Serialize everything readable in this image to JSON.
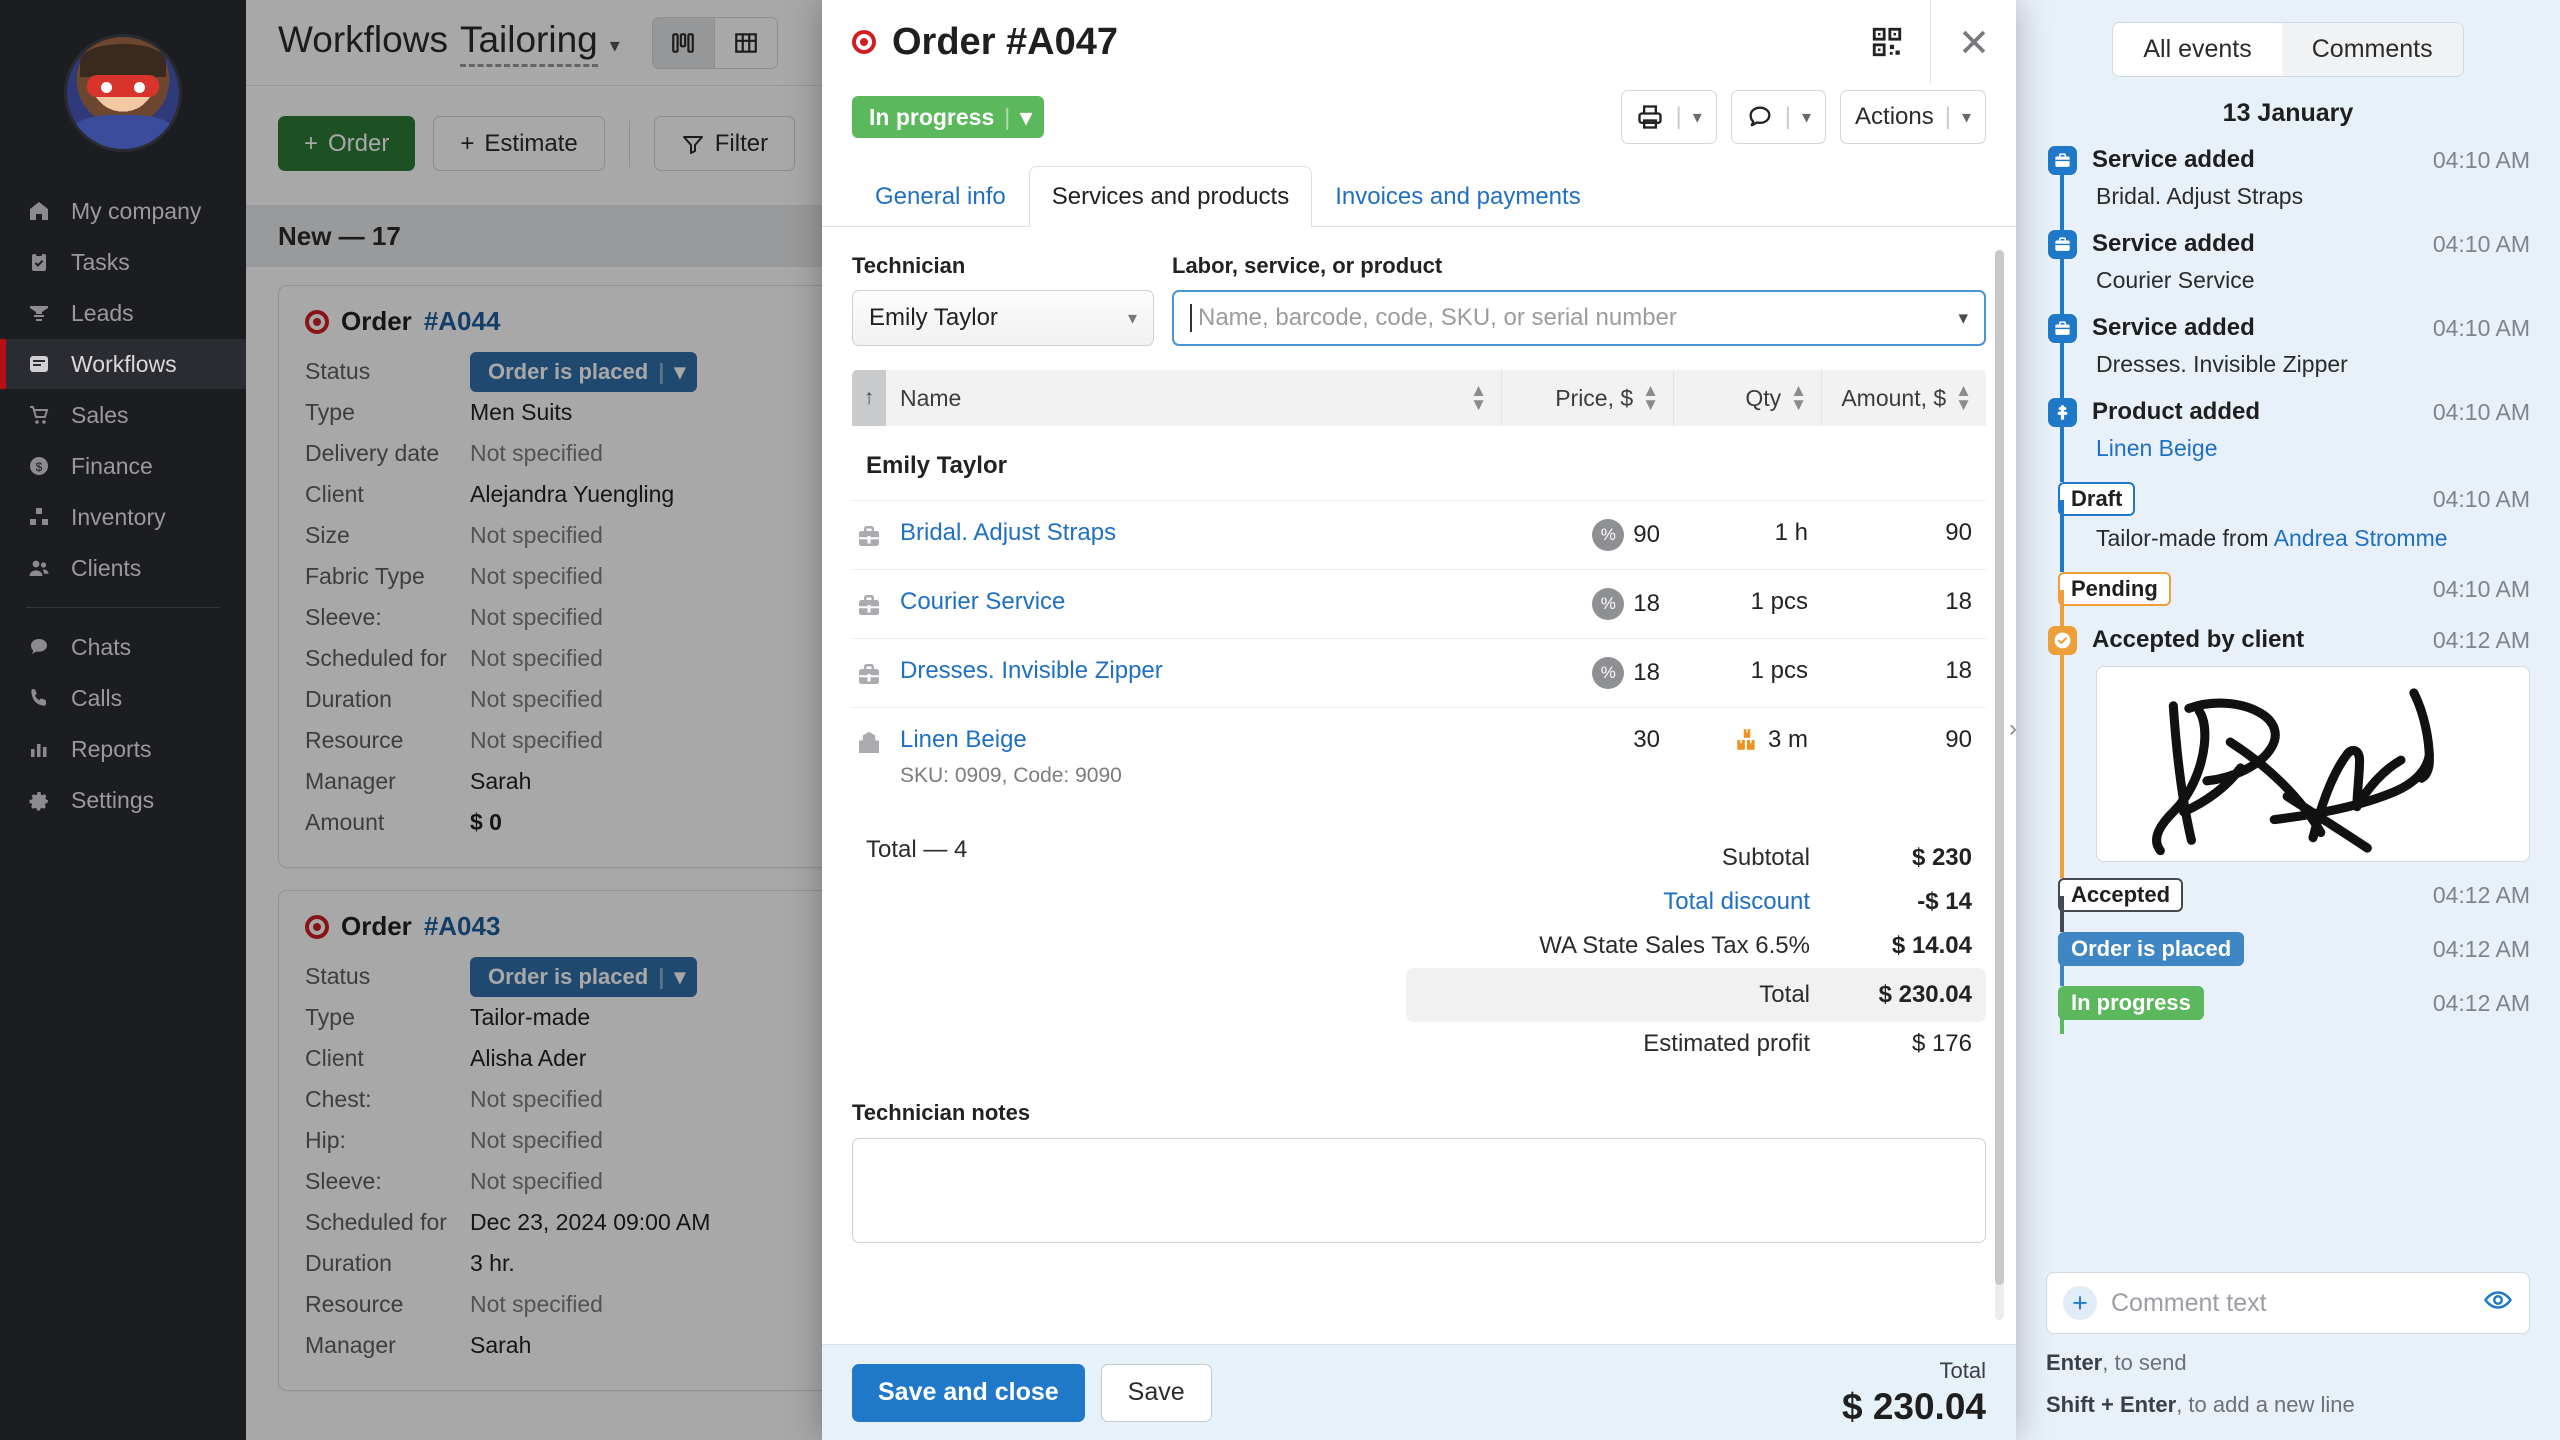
{
  "sidebar": {
    "avatar_name": "user-avatar",
    "items": [
      {
        "label": "My company",
        "icon": "home-icon"
      },
      {
        "label": "Tasks",
        "icon": "clipboard-check-icon"
      },
      {
        "label": "Leads",
        "icon": "funnel-icon"
      },
      {
        "label": "Workflows",
        "icon": "inbox-icon",
        "active": true
      },
      {
        "label": "Sales",
        "icon": "cart-icon"
      },
      {
        "label": "Finance",
        "icon": "dollar-circle-icon"
      },
      {
        "label": "Inventory",
        "icon": "boxes-icon"
      },
      {
        "label": "Clients",
        "icon": "people-icon"
      },
      {
        "label": "Chats",
        "icon": "chat-icon"
      },
      {
        "label": "Calls",
        "icon": "phone-icon"
      },
      {
        "label": "Reports",
        "icon": "bar-chart-icon"
      },
      {
        "label": "Settings",
        "icon": "gear-icon"
      }
    ]
  },
  "background": {
    "title_primary": "Workflows",
    "title_secondary": "Tailoring",
    "buttons": {
      "order": "Order",
      "estimate": "Estimate",
      "filter": "Filter"
    },
    "column_header": "New — 17",
    "cards": [
      {
        "number": "#A044",
        "prefix": "Order",
        "status": "Order is placed",
        "rows": [
          {
            "label": "Type",
            "value": "Men Suits",
            "muted": false
          },
          {
            "label": "Delivery date",
            "value": "Not specified",
            "muted": true
          },
          {
            "label": "Client",
            "value": "Alejandra Yuengling",
            "muted": false
          },
          {
            "label": "Size",
            "value": "Not specified",
            "muted": true
          },
          {
            "label": "Fabric Type",
            "value": "Not specified",
            "muted": true
          },
          {
            "label": "Sleeve:",
            "value": "Not specified",
            "muted": true
          },
          {
            "label": "Scheduled for",
            "value": "Not specified",
            "muted": true
          },
          {
            "label": "Duration",
            "value": "Not specified",
            "muted": true
          },
          {
            "label": "Resource",
            "value": "Not specified",
            "muted": true
          },
          {
            "label": "Manager",
            "value": "Sarah",
            "muted": false
          },
          {
            "label": "Amount",
            "value": "$ 0",
            "muted": false,
            "bold": true
          }
        ],
        "status_label": "Status"
      },
      {
        "number": "#A043",
        "prefix": "Order",
        "status": "Order is placed",
        "rows": [
          {
            "label": "Type",
            "value": "Tailor-made",
            "muted": false
          },
          {
            "label": "Client",
            "value": "Alisha Ader",
            "muted": false
          },
          {
            "label": "Chest:",
            "value": "Not specified",
            "muted": true
          },
          {
            "label": "Hip:",
            "value": "Not specified",
            "muted": true
          },
          {
            "label": "Sleeve:",
            "value": "Not specified",
            "muted": true
          },
          {
            "label": "Scheduled for",
            "value": "Dec 23, 2024 09:00 AM",
            "muted": false
          },
          {
            "label": "Duration",
            "value": "3 hr.",
            "muted": false
          },
          {
            "label": "Resource",
            "value": "Not specified",
            "muted": true
          },
          {
            "label": "Manager",
            "value": "Sarah",
            "muted": false
          }
        ],
        "status_label": "Status"
      }
    ]
  },
  "modal": {
    "title": "Order #A047",
    "status_badge": "In progress",
    "toolbar": {
      "print": "print-icon",
      "comment": "comment-icon",
      "actions": "Actions"
    },
    "tabs": [
      {
        "label": "General info",
        "active": false
      },
      {
        "label": "Services and products",
        "active": true
      },
      {
        "label": "Invoices and payments",
        "active": false
      }
    ],
    "technician_label": "Technician",
    "technician_value": "Emily Taylor",
    "search_label": "Labor, service, or product",
    "search_placeholder": "Name, barcode, code, SKU, or serial number",
    "table": {
      "headers": {
        "name": "Name",
        "price": "Price, $",
        "qty": "Qty",
        "amount": "Amount, $"
      },
      "group": "Emily Taylor",
      "rows": [
        {
          "name": "Bridal. Adjust Straps",
          "icon": "service-toolbox-icon",
          "has_discount": true,
          "price": "90",
          "qty": "1 h",
          "qty_icon": false,
          "amount": "90",
          "sub": ""
        },
        {
          "name": "Courier Service",
          "icon": "service-toolbox-icon",
          "has_discount": true,
          "price": "18",
          "qty": "1 pcs",
          "qty_icon": false,
          "amount": "18",
          "sub": ""
        },
        {
          "name": "Dresses. Invisible Zipper",
          "icon": "service-toolbox-icon",
          "has_discount": true,
          "price": "18",
          "qty": "1 pcs",
          "qty_icon": false,
          "amount": "18",
          "sub": ""
        },
        {
          "name": "Linen Beige",
          "icon": "product-box-icon",
          "has_discount": false,
          "price": "30",
          "qty": "3 m",
          "qty_icon": true,
          "amount": "90",
          "sub": "SKU: 0909, Code: 9090"
        }
      ]
    },
    "totals": {
      "count_label": "Total — 4",
      "subtotal_label": "Subtotal",
      "subtotal_value": "$ 230",
      "discount_label": "Total discount",
      "discount_value": "-$ 14",
      "tax_label": "WA State Sales Tax 6.5%",
      "tax_value": "$ 14.04",
      "total_label": "Total",
      "total_value": "$ 230.04",
      "profit_label": "Estimated profit",
      "profit_value": "$ 176"
    },
    "notes_label": "Technician notes",
    "notes_value": "",
    "footer": {
      "save_and_close": "Save and close",
      "save": "Save",
      "total_label": "Total",
      "total_value": "$ 230.04"
    }
  },
  "activity": {
    "tabs": [
      {
        "label": "All events",
        "active": true
      },
      {
        "label": "Comments",
        "active": false
      }
    ],
    "day": "13 January",
    "events": [
      {
        "kind": "icon",
        "icon": "briefcase-icon",
        "color": "#2079c8",
        "line_color": "#2079c8",
        "title": "Service added",
        "time": "04:10 AM",
        "sub": "Bridal. Adjust Straps"
      },
      {
        "kind": "icon",
        "icon": "briefcase-icon",
        "color": "#2079c8",
        "line_color": "#2079c8",
        "title": "Service added",
        "time": "04:10 AM",
        "sub": "Courier Service"
      },
      {
        "kind": "icon",
        "icon": "briefcase-icon",
        "color": "#2079c8",
        "line_color": "#2079c8",
        "title": "Service added",
        "time": "04:10 AM",
        "sub": "Dresses. Invisible Zipper"
      },
      {
        "kind": "icon",
        "icon": "puzzle-icon",
        "color": "#2079c8",
        "line_color": "#2079c8",
        "title": "Product added",
        "time": "04:10 AM",
        "sub_link": "Linen Beige"
      },
      {
        "kind": "badge-outline",
        "badge": "Draft",
        "border_color": "#2079c8",
        "line_color": "#2079c8",
        "time": "04:10 AM",
        "sub_prefix": "Tailor-made from ",
        "sub_link": "Andrea Stromme"
      },
      {
        "kind": "badge-outline",
        "badge": "Pending",
        "border_color": "#eda03a",
        "line_color": "#eda03a",
        "time": "04:10 AM"
      },
      {
        "kind": "icon",
        "icon": "check-circle-icon",
        "color": "#eda03a",
        "line_color": "#eda03a",
        "title": "Accepted by client",
        "time": "04:12 AM",
        "signature": true
      },
      {
        "kind": "badge-outline",
        "badge": "Accepted",
        "border_color": "#454a52",
        "line_color": "#454a52",
        "time": "04:12 AM"
      },
      {
        "kind": "badge-filled",
        "badge": "Order is placed",
        "bg_color": "#3f86c4",
        "line_color": "#3f86c4",
        "time": "04:12 AM"
      },
      {
        "kind": "badge-filled",
        "badge": "In progress",
        "bg_color": "#5cb85c",
        "line_color": "#5cb85c",
        "time": "04:12 AM"
      }
    ],
    "comment_placeholder": "Comment text",
    "hints": [
      {
        "bold": "Enter",
        "rest": ", to send"
      },
      {
        "bold": "Shift + Enter",
        "rest": ", to add a new line"
      }
    ]
  }
}
